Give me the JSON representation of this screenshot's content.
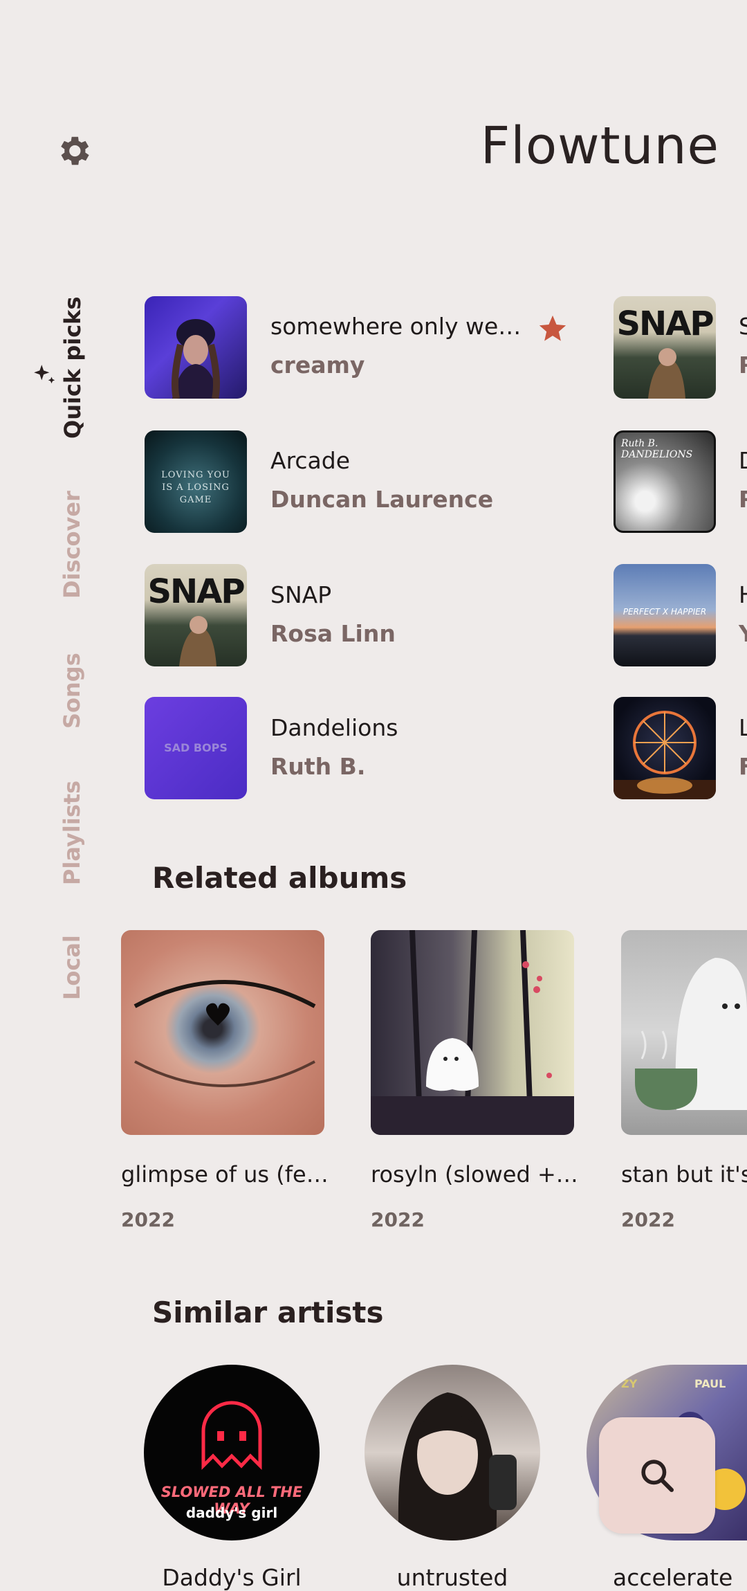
{
  "header": {
    "title": "Flowtune",
    "settings_icon": "gear-icon"
  },
  "rail": {
    "items": [
      {
        "label": "Quick picks",
        "active": true,
        "icon": "sparkle-icon"
      },
      {
        "label": "Discover"
      },
      {
        "label": "Songs"
      },
      {
        "label": "Playlists"
      },
      {
        "label": "Local"
      }
    ]
  },
  "quick_picks": {
    "col1": [
      {
        "title": "somewhere only we…",
        "artist": "creamy",
        "starred": true
      },
      {
        "title": "Arcade",
        "artist": "Duncan Laurence"
      },
      {
        "title": "SNAP",
        "artist": "Rosa Linn"
      },
      {
        "title": "Dandelions",
        "artist": "Ruth B."
      }
    ],
    "col2_cover_texts": [
      "SNAP",
      "Ruth B. DANDELIONS",
      "PERFECT X HAPPIER",
      ""
    ],
    "cover_texts": [
      "",
      "LOVING YOU IS A LOSING GAME",
      "SNAP",
      "SAD BOPS"
    ],
    "col2_title_initials": [
      "S",
      "D",
      "H",
      "L"
    ],
    "col2_artist_initials": [
      "R",
      "R",
      "Y",
      "F"
    ]
  },
  "related_albums": {
    "title": "Related albums",
    "items": [
      {
        "title": "glimpse of us (fe…",
        "year": "2022"
      },
      {
        "title": "rosyln (slowed +…",
        "year": "2022"
      },
      {
        "title": "stan but it's",
        "year": "2022"
      }
    ]
  },
  "similar_artists": {
    "title": "Similar artists",
    "items": [
      {
        "name": "Daddy's Girl",
        "cover_line1": "SLOWED ALL THE WAY",
        "cover_line2": "daddy's girl"
      },
      {
        "name": "untrusted"
      },
      {
        "name": "accelerate",
        "cover_text_left": "ZY",
        "cover_text_right": "PAUL"
      }
    ]
  },
  "fab": {
    "icon": "search-icon"
  },
  "colors": {
    "accent": "#c8573f",
    "rail_inactive": "#c6a9a4",
    "fab_bg": "#eed6d1"
  }
}
